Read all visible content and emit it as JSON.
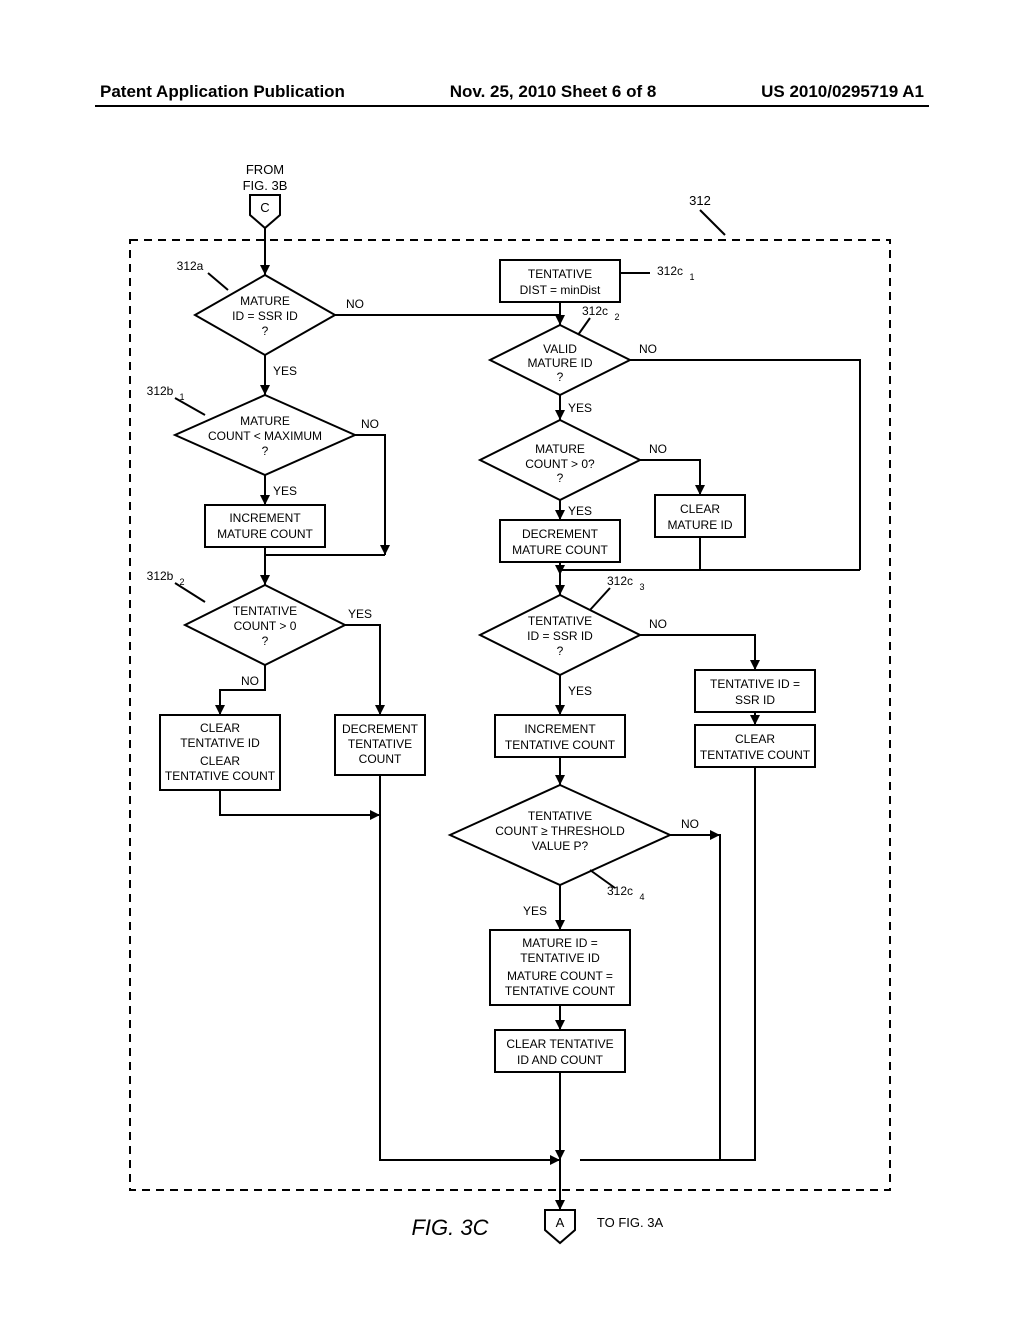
{
  "header": {
    "left": "Patent Application Publication",
    "center": "Nov. 25, 2010  Sheet 6 of 8",
    "right": "US 2010/0295719 A1"
  },
  "figure_label": "FIG. 3C",
  "from_label_1": "FROM",
  "from_label_2": "FIG. 3B",
  "connector_c": "C",
  "connector_a": "A",
  "to_label": "TO FIG. 3A",
  "ref_312": "312",
  "ref_312a": "312a",
  "ref_312b1": "312b",
  "ref_312b1_sub": "1",
  "ref_312b2": "312b",
  "ref_312b2_sub": "2",
  "ref_312c1": "312c",
  "ref_312c1_sub": "1",
  "ref_312c2": "312c",
  "ref_312c2_sub": "2",
  "ref_312c3": "312c",
  "ref_312c3_sub": "3",
  "ref_312c4": "312c",
  "ref_312c4_sub": "4",
  "yes": "YES",
  "no": "NO",
  "d_312a_1": "MATURE",
  "d_312a_2": "ID = SSR ID",
  "d_312a_3": "?",
  "d_312b1_1": "MATURE",
  "d_312b1_2": "COUNT < MAXIMUM",
  "d_312b1_3": "?",
  "r_inc_mature": "INCREMENT",
  "r_inc_mature2": "MATURE COUNT",
  "d_312b2_1": "TENTATIVE",
  "d_312b2_2": "COUNT > 0",
  "d_312b2_3": "?",
  "r_clear_tent1": "CLEAR",
  "r_clear_tent2": "TENTATIVE ID",
  "r_clear_tent3": "CLEAR",
  "r_clear_tent4": "TENTATIVE COUNT",
  "r_dec_tent1": "DECREMENT",
  "r_dec_tent2": "TENTATIVE",
  "r_dec_tent3": "COUNT",
  "r_312c1_1": "TENTATIVE",
  "r_312c1_2": "DIST = minDist",
  "d_312c2_1": "VALID",
  "d_312c2_2": "MATURE ID",
  "d_312c2_3": "?",
  "d_mature_gt0_1": "MATURE",
  "d_mature_gt0_2": "COUNT > 0?",
  "d_mature_gt0_3": "?",
  "r_dec_mature1": "DECREMENT",
  "r_dec_mature2": "MATURE COUNT",
  "r_clear_mature1": "CLEAR",
  "r_clear_mature2": "MATURE ID",
  "d_312c3_1": "TENTATIVE",
  "d_312c3_2": "ID = SSR ID",
  "d_312c3_3": "?",
  "r_inc_tent1": "INCREMENT",
  "r_inc_tent2": "TENTATIVE COUNT",
  "r_tent_ssr1": "TENTATIVE ID =",
  "r_tent_ssr2": "SSR ID",
  "r_clear_tentc1": "CLEAR",
  "r_clear_tentc2": "TENTATIVE COUNT",
  "d_312c4_1": "TENTATIVE",
  "d_312c4_2": "COUNT ≥ THRESHOLD",
  "d_312c4_3": "VALUE P?",
  "r_mature_tent1": "MATURE ID =",
  "r_mature_tent2": "TENTATIVE ID",
  "r_mature_tent3": "MATURE COUNT =",
  "r_mature_tent4": "TENTATIVE COUNT",
  "r_clear_all1": "CLEAR TENTATIVE",
  "r_clear_all2": "ID AND COUNT"
}
